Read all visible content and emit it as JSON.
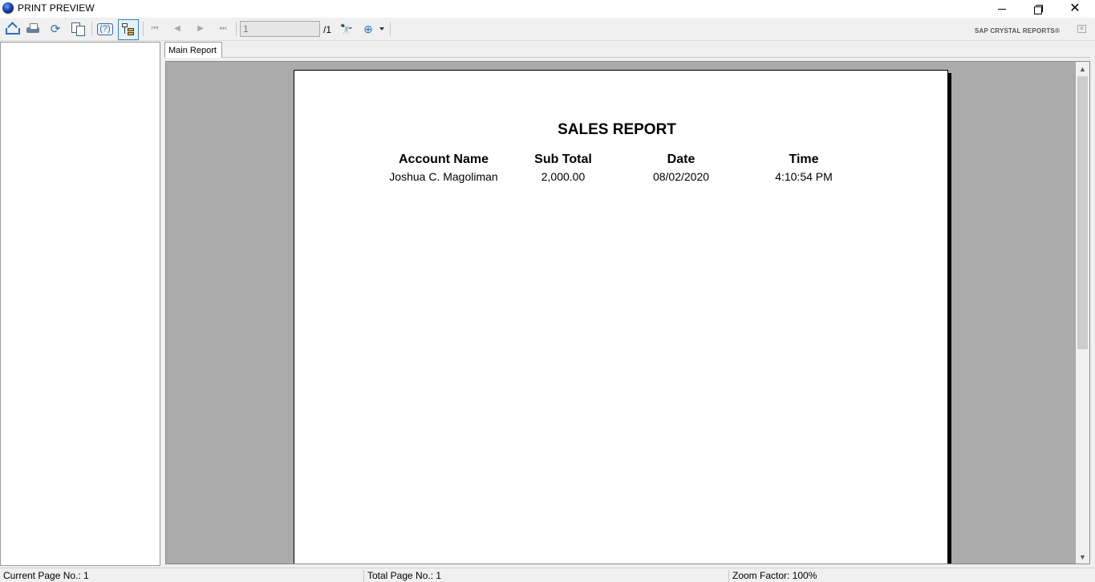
{
  "window": {
    "title": "PRINT PREVIEW",
    "minimize_icon": "minimize-icon",
    "maximize_icon": "restore-icon",
    "close_glyph": "✕"
  },
  "toolbar": {
    "buttons": [
      {
        "icon": "export-icon"
      },
      {
        "icon": "print-icon"
      },
      {
        "icon": "refresh-icon",
        "glyph": "⟳"
      },
      {
        "icon": "copy-icon"
      },
      {
        "icon": "help-icon",
        "glyph": "(?)"
      },
      {
        "icon": "group-tree-icon",
        "active": true
      }
    ],
    "nav": {
      "first_glyph": "⏮",
      "prev_glyph": "◀",
      "next_glyph": "▶",
      "last_glyph": "⏭"
    },
    "page_input_value": "1",
    "page_total": "/1",
    "find_glyph": "🔭",
    "zoom_glyph": "⊕",
    "brand": "SAP CRYSTAL REPORTS®",
    "brand_close": "✕"
  },
  "tabs": [
    {
      "label": "Main Report"
    }
  ],
  "report": {
    "title": "SALES REPORT",
    "columns": [
      "Account  Name",
      "Sub  Total",
      "Date",
      "Time"
    ],
    "rows": [
      [
        "Joshua C. Magoliman",
        "2,000.00",
        "08/02/2020",
        "4:10:54 PM"
      ]
    ]
  },
  "scrollbar": {
    "up_glyph": "▲",
    "down_glyph": "▼"
  },
  "status": {
    "current_page": "Current Page No.: 1",
    "total_page": "Total Page No.: 1",
    "zoom_factor": "Zoom Factor: 100%"
  },
  "colors": {
    "viewport_bg": "#ababab",
    "accent": "#2f6db5"
  }
}
